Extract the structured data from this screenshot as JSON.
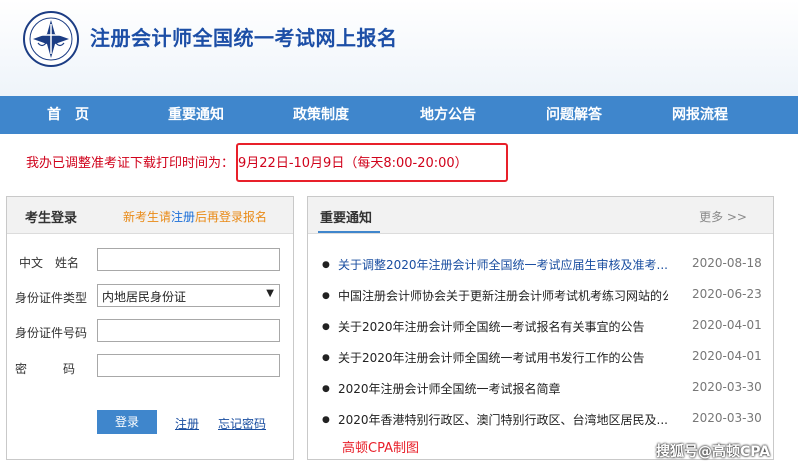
{
  "header": {
    "title": "注册会计师全国统一考试网上报名"
  },
  "nav": {
    "items": [
      "首　页",
      "重要通知",
      "政策制度",
      "地方公告",
      "问题解答",
      "网报流程"
    ]
  },
  "notice": {
    "prefix": "我办已调整准考证下载打印时间为：",
    "highlight": "9月22日-10月9日（每天8:00-20:00）"
  },
  "login": {
    "title": "考生登录",
    "tip_prefix": "新考生请",
    "tip_register": "注册",
    "tip_suffix": "后再登录报名",
    "fields": {
      "name_label": "中文　姓名",
      "id_type_label": "身份证件类型",
      "id_type_value": "内地居民身份证",
      "id_number_label": "身份证件号码",
      "password_label": "密　　　码"
    },
    "login_button": "登录",
    "register_link": "注册",
    "forgot_link": "忘记密码"
  },
  "news": {
    "title": "重要通知",
    "more": "更多 >>",
    "items": [
      {
        "text": "关于调整2020年注册会计师全国统一考试应届生审核及准考...",
        "date": "2020-08-18"
      },
      {
        "text": "中国注册会计师协会关于更新注册会计师考试机考练习网站的公...",
        "date": "2020-06-23"
      },
      {
        "text": "关于2020年注册会计师全国统一考试报名有关事宜的公告",
        "date": "2020-04-01"
      },
      {
        "text": "关于2020年注册会计师全国统一考试用书发行工作的公告",
        "date": "2020-04-01"
      },
      {
        "text": "2020年注册会计师全国统一考试报名简章",
        "date": "2020-03-30"
      },
      {
        "text": "2020年香港特别行政区、澳门特别行政区、台湾地区居民及...",
        "date": "2020-03-30"
      }
    ]
  },
  "credit": "高顿CPA制图",
  "watermark": "搜狐号@高顿CPA",
  "colors": {
    "nav_bg": "#3f86cc",
    "title_blue": "#1c4ea6",
    "notice_red": "#d0021b",
    "tip_orange": "#e98a16"
  }
}
